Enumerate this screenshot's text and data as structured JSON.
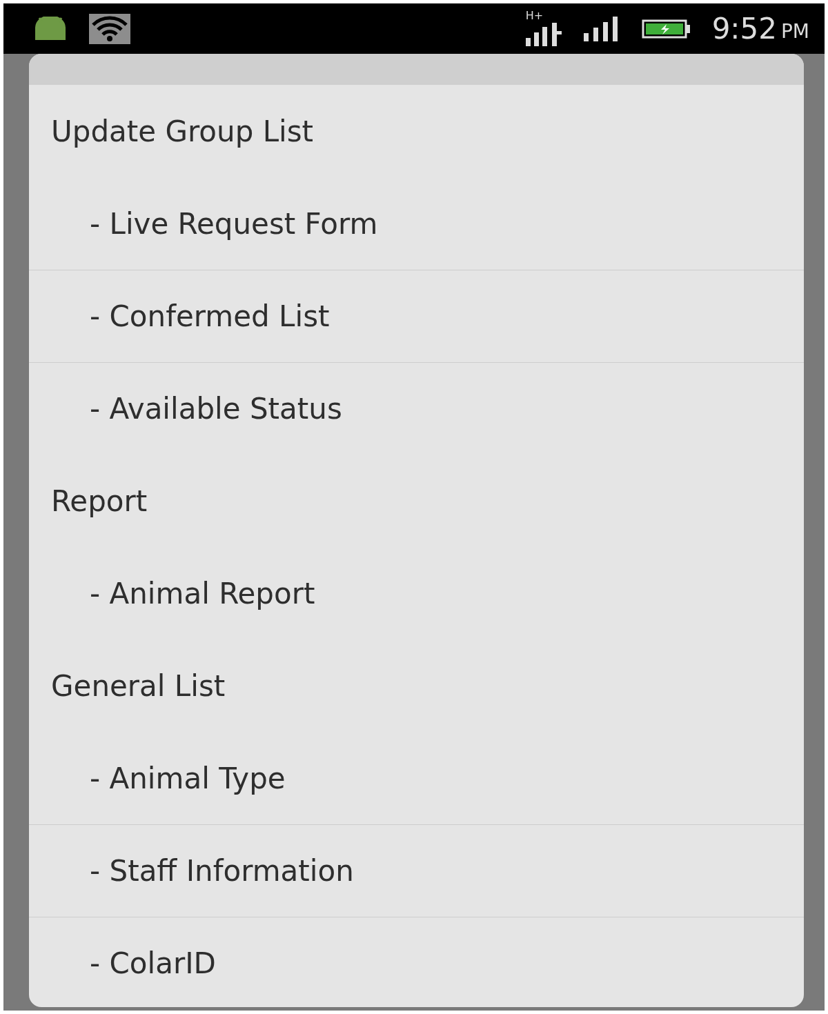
{
  "status_bar": {
    "network_type": "H+",
    "time": "9:52",
    "meridiem": "PM"
  },
  "menu": {
    "items": [
      {
        "kind": "header",
        "label": "Update Group List"
      },
      {
        "kind": "sub",
        "label": "- Live Request Form"
      },
      {
        "kind": "sub",
        "label": "- Confermed List"
      },
      {
        "kind": "sub",
        "label": "- Available Status"
      },
      {
        "kind": "header",
        "label": "Report"
      },
      {
        "kind": "sub",
        "label": "- Animal Report"
      },
      {
        "kind": "header",
        "label": "General List"
      },
      {
        "kind": "sub",
        "label": "- Animal Type"
      },
      {
        "kind": "sub",
        "label": "- Staff Information"
      },
      {
        "kind": "sub",
        "label": "- ColarID"
      }
    ]
  }
}
